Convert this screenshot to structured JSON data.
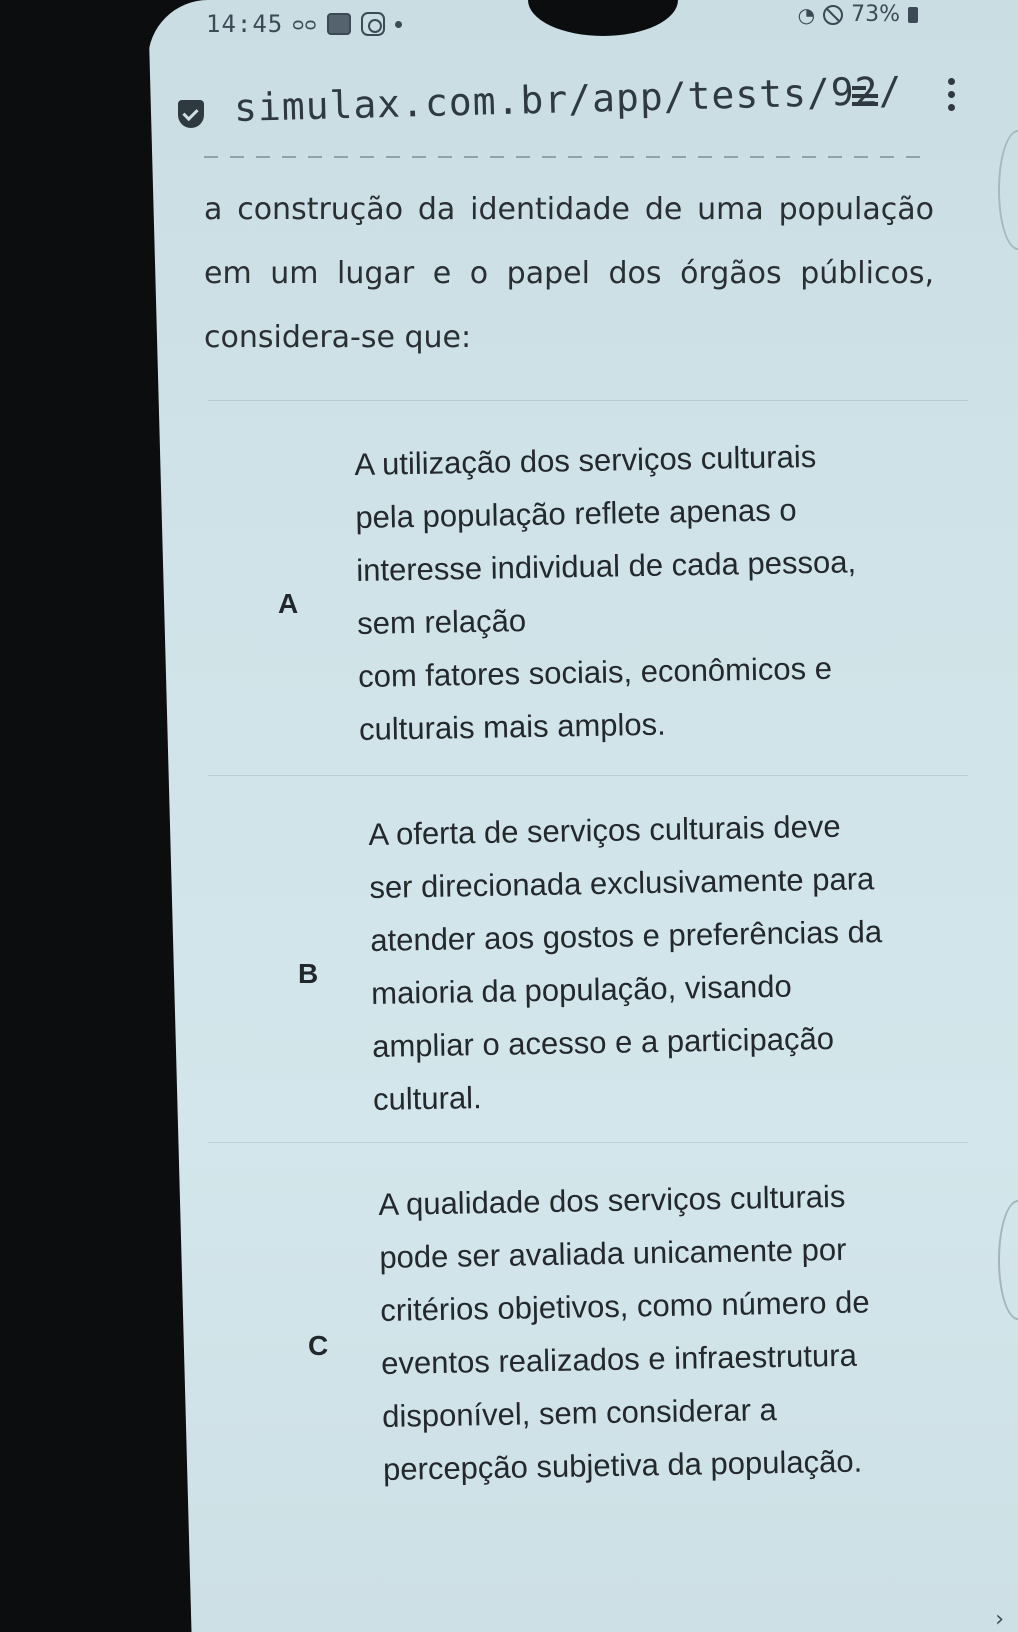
{
  "status_bar": {
    "time": "14:45",
    "battery": "73%",
    "icons_left": [
      "voicemail-icon",
      "gallery-icon",
      "instagram-icon",
      "dot-icon"
    ],
    "icons_right": [
      "wifi-icon",
      "do-not-disturb-icon",
      "battery-icon"
    ]
  },
  "address_bar": {
    "url": "simulax.com.br/app/tests/92/"
  },
  "question": {
    "text": "a construção da identidade de uma população em um lugar e o papel dos órgãos públicos, considera-se que:"
  },
  "options": [
    {
      "letter": "A",
      "text": "A utilização dos serviços culturais\npela população reflete apenas o\ninteresse individual de cada pessoa,\nsem relação\ncom fatores sociais, econômicos e\nculturais mais amplos."
    },
    {
      "letter": "B",
      "text": "A oferta de serviços culturais deve\nser direcionada exclusivamente para\natender aos gostos e preferências da\nmaioria da população, visando\nampliar o acesso e a participação\ncultural."
    },
    {
      "letter": "C",
      "text": "A qualidade dos serviços culturais\npode ser avaliada unicamente por\ncritérios objetivos, como número de\neventos realizados e infraestrutura\ndisponível, sem considerar a\npercepção subjetiva da população."
    }
  ]
}
